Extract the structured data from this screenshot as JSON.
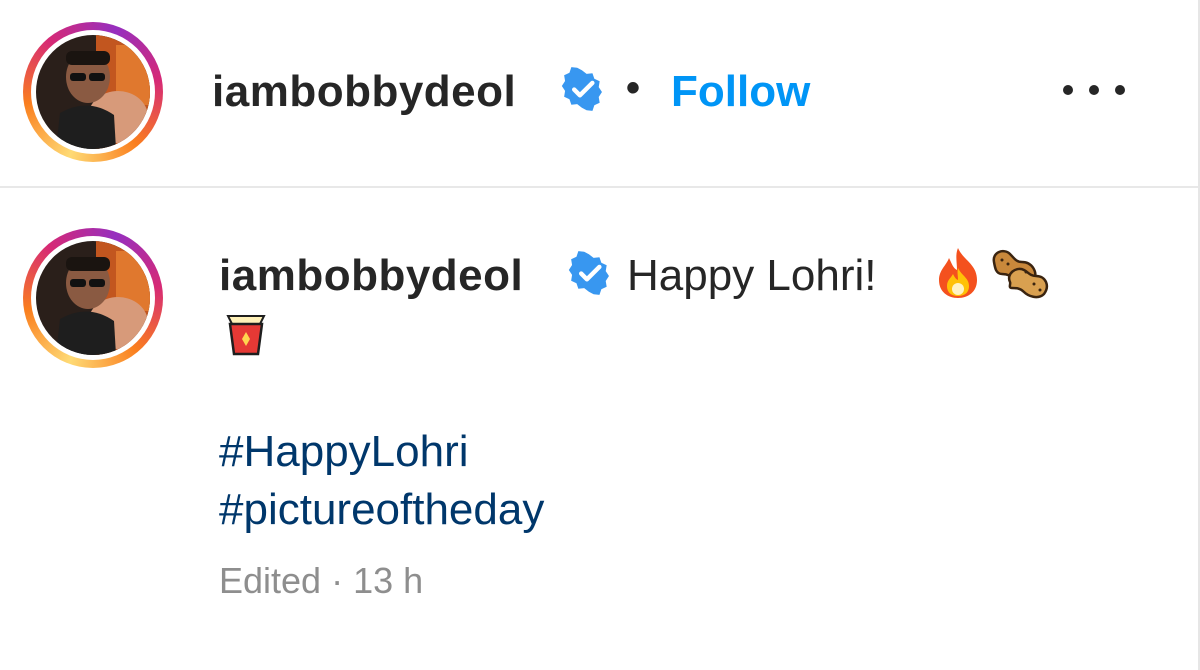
{
  "post_header": {
    "username": "iambobbydeol",
    "separator": "•",
    "follow_label": "Follow"
  },
  "caption": {
    "username": "iambobbydeol",
    "text": "Happy Lohri!",
    "emojis": [
      "fire-emoji",
      "peanuts-emoji",
      "red-envelope-emoji"
    ],
    "hashtags": [
      "#HappyLohri",
      "#pictureoftheday"
    ],
    "meta": "Edited · 13 h"
  },
  "icons": {
    "verified": "verified-badge-icon",
    "more": "more-options-icon"
  },
  "colors": {
    "follow": "#0095f6",
    "verified": "#3897f0",
    "hashtag": "#00376b",
    "text": "#262626",
    "meta": "#8e8e8e"
  }
}
